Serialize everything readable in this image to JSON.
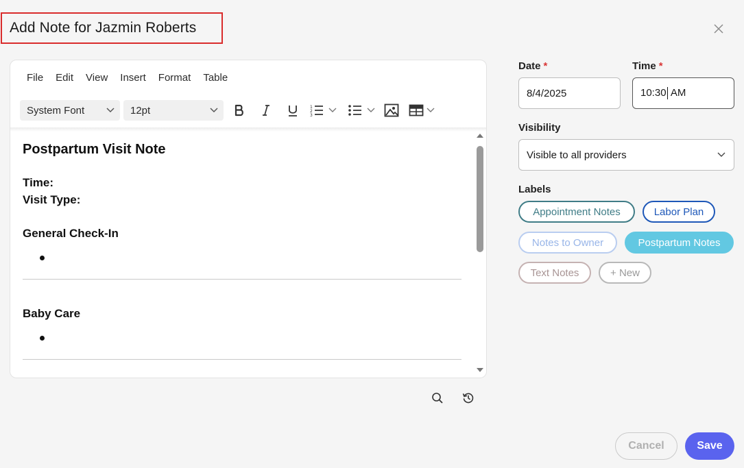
{
  "dialog": {
    "title": "Add Note for Jazmin Roberts"
  },
  "editor": {
    "menu": [
      "File",
      "Edit",
      "View",
      "Insert",
      "Format",
      "Table"
    ],
    "font_family": "System Font",
    "font_size": "12pt",
    "content": {
      "heading": "Postpartum Visit Note",
      "time_label": "Time:",
      "visit_type_label": "Visit Type:",
      "section1": "General Check-In",
      "section2": "Baby Care"
    }
  },
  "form": {
    "date_label": "Date",
    "date_value": "8/4/2025",
    "time_label": "Time",
    "time_value_before_caret": "10:30",
    "time_value_after_caret": " AM",
    "required_marker": "*",
    "visibility_label": "Visibility",
    "visibility_value": "Visible to all providers",
    "labels_label": "Labels",
    "labels": [
      {
        "text": "Appointment Notes",
        "color": "#3f7c86"
      },
      {
        "text": "Labor Plan",
        "color": "#1d57b8"
      },
      {
        "text": "Notes to Owner",
        "color": "#98b5e8"
      },
      {
        "text": "Postpartum Notes",
        "color": "#62c8e2",
        "selected": true
      },
      {
        "text": "Text Notes",
        "color": "#a89494"
      },
      {
        "text": "+ New",
        "color": "#9a9a9a"
      }
    ]
  },
  "actions": {
    "cancel": "Cancel",
    "save": "Save"
  },
  "colors": {
    "accent": "#5a63ee",
    "highlight_border": "#d92b2b",
    "required": "#d93636"
  }
}
